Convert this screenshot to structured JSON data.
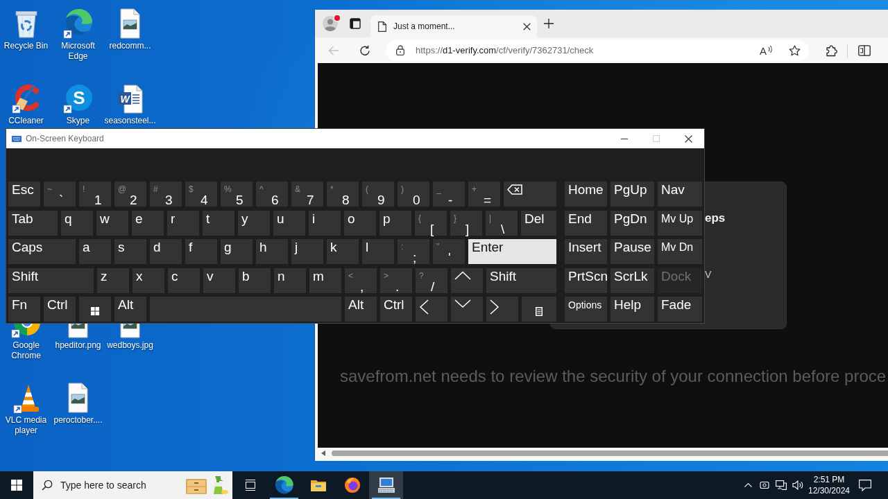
{
  "desktop": {
    "icons": [
      {
        "label": "Recycle Bin",
        "kind": "recycle",
        "shortcut": false
      },
      {
        "label": "CCleaner",
        "kind": "ccleaner",
        "shortcut": true
      },
      {
        "label": "Google Chrome",
        "kind": "chrome",
        "shortcut": true
      },
      {
        "label": "VLC media player",
        "kind": "vlc",
        "shortcut": true
      },
      {
        "label": "Microsoft Edge",
        "kind": "edge",
        "shortcut": true
      },
      {
        "label": "Skype",
        "kind": "skype",
        "shortcut": true,
        "glyph": "S"
      },
      {
        "label": "hpeditor.png",
        "kind": "image",
        "shortcut": false
      },
      {
        "label": "peroctober....",
        "kind": "image",
        "shortcut": false
      },
      {
        "label": "redcomm...",
        "kind": "image",
        "shortcut": false
      },
      {
        "label": "seasonsteel...",
        "kind": "word",
        "shortcut": false,
        "glyph": "W"
      },
      {
        "label": "wedboys.jpg",
        "kind": "image",
        "shortcut": false
      }
    ]
  },
  "browser": {
    "profile_badge": true,
    "tabs": [
      {
        "title": "Just a moment...",
        "selected": true
      }
    ],
    "back": {
      "disabled": true
    },
    "address": {
      "scheme": "https://",
      "host": "d1-verify.com",
      "path": "/cf/verify/7362731/check"
    },
    "read_aloud": {
      "glyph": "A"
    },
    "page": {
      "card": {
        "heading": "eps",
        "line": "V"
      },
      "message": "savefrom.net needs to review the security of your connection before proce"
    }
  },
  "keyboard": {
    "title": "On-Screen Keyboard",
    "controls": [
      {
        "kind": "minimize",
        "disabled": false
      },
      {
        "kind": "maximize",
        "disabled": true
      },
      {
        "kind": "close",
        "disabled": false
      }
    ],
    "main_rows": [
      [
        {
          "kind": "text",
          "label": "Esc",
          "highlighted": false,
          "disabled": false
        },
        {
          "kind": "dual",
          "shift": "~",
          "label": "`",
          "highlighted": false,
          "disabled": false
        },
        {
          "kind": "dual",
          "shift": "!",
          "label": "1",
          "highlighted": false,
          "disabled": false
        },
        {
          "kind": "dual",
          "shift": "@",
          "label": "2",
          "highlighted": false,
          "disabled": false
        },
        {
          "kind": "dual",
          "shift": "#",
          "label": "3",
          "highlighted": false,
          "disabled": false
        },
        {
          "kind": "dual",
          "shift": "$",
          "label": "4",
          "highlighted": false,
          "disabled": false
        },
        {
          "kind": "dual",
          "shift": "%",
          "label": "5",
          "highlighted": false,
          "disabled": false
        },
        {
          "kind": "dual",
          "shift": "^",
          "label": "6",
          "highlighted": false,
          "disabled": false
        },
        {
          "kind": "dual",
          "shift": "&",
          "label": "7",
          "highlighted": false,
          "disabled": false
        },
        {
          "kind": "dual",
          "shift": "*",
          "label": "8",
          "highlighted": false,
          "disabled": false
        },
        {
          "kind": "dual",
          "shift": "(",
          "label": "9",
          "highlighted": false,
          "disabled": false
        },
        {
          "kind": "dual",
          "shift": ")",
          "label": "0",
          "highlighted": false,
          "disabled": false
        },
        {
          "kind": "dual",
          "shift": "_",
          "label": "-",
          "highlighted": false,
          "disabled": false
        },
        {
          "kind": "dual",
          "shift": "+",
          "label": "=",
          "highlighted": false,
          "disabled": false
        },
        {
          "kind": "backspace",
          "highlighted": false,
          "disabled": false
        }
      ],
      [
        {
          "kind": "text",
          "label": "Tab",
          "highlighted": false,
          "disabled": false
        },
        {
          "kind": "text",
          "label": "q",
          "highlighted": false,
          "disabled": false
        },
        {
          "kind": "text",
          "label": "w",
          "highlighted": false,
          "disabled": false
        },
        {
          "kind": "text",
          "label": "e",
          "highlighted": false,
          "disabled": false
        },
        {
          "kind": "text",
          "label": "r",
          "highlighted": false,
          "disabled": false
        },
        {
          "kind": "text",
          "label": "t",
          "highlighted": false,
          "disabled": false
        },
        {
          "kind": "text",
          "label": "y",
          "highlighted": false,
          "disabled": false
        },
        {
          "kind": "text",
          "label": "u",
          "highlighted": false,
          "disabled": false
        },
        {
          "kind": "text",
          "label": "i",
          "highlighted": false,
          "disabled": false
        },
        {
          "kind": "text",
          "label": "o",
          "highlighted": false,
          "disabled": false
        },
        {
          "kind": "text",
          "label": "p",
          "highlighted": false,
          "disabled": false
        },
        {
          "kind": "dual",
          "shift": "{",
          "label": "[",
          "highlighted": false,
          "disabled": false
        },
        {
          "kind": "dual",
          "shift": "}",
          "label": "]",
          "highlighted": false,
          "disabled": false
        },
        {
          "kind": "dual",
          "shift": "|",
          "label": "\\",
          "highlighted": false,
          "disabled": false
        },
        {
          "kind": "text",
          "label": "Del",
          "highlighted": false,
          "disabled": false
        }
      ],
      [
        {
          "kind": "text",
          "label": "Caps",
          "highlighted": false,
          "disabled": false
        },
        {
          "kind": "text",
          "label": "a",
          "highlighted": false,
          "disabled": false
        },
        {
          "kind": "text",
          "label": "s",
          "highlighted": false,
          "disabled": false
        },
        {
          "kind": "text",
          "label": "d",
          "highlighted": false,
          "disabled": false
        },
        {
          "kind": "text",
          "label": "f",
          "highlighted": false,
          "disabled": false
        },
        {
          "kind": "text",
          "label": "g",
          "highlighted": false,
          "disabled": false
        },
        {
          "kind": "text",
          "label": "h",
          "highlighted": false,
          "disabled": false
        },
        {
          "kind": "text",
          "label": "j",
          "highlighted": false,
          "disabled": false
        },
        {
          "kind": "text",
          "label": "k",
          "highlighted": false,
          "disabled": false
        },
        {
          "kind": "text",
          "label": "l",
          "highlighted": false,
          "disabled": false
        },
        {
          "kind": "dual",
          "shift": ":",
          "label": ";",
          "highlighted": false,
          "disabled": false
        },
        {
          "kind": "dual",
          "shift": "\"",
          "label": "'",
          "highlighted": false,
          "disabled": false
        },
        {
          "kind": "text",
          "label": "Enter",
          "highlighted": true,
          "disabled": false
        }
      ],
      [
        {
          "kind": "text",
          "label": "Shift",
          "highlighted": false,
          "disabled": false
        },
        {
          "kind": "text",
          "label": "z",
          "highlighted": false,
          "disabled": false
        },
        {
          "kind": "text",
          "label": "x",
          "highlighted": false,
          "disabled": false
        },
        {
          "kind": "text",
          "label": "c",
          "highlighted": false,
          "disabled": false
        },
        {
          "kind": "text",
          "label": "v",
          "highlighted": false,
          "disabled": false
        },
        {
          "kind": "text",
          "label": "b",
          "highlighted": false,
          "disabled": false
        },
        {
          "kind": "text",
          "label": "n",
          "highlighted": false,
          "disabled": false
        },
        {
          "kind": "text",
          "label": "m",
          "highlighted": false,
          "disabled": false
        },
        {
          "kind": "dual",
          "shift": "<",
          "label": ",",
          "highlighted": false,
          "disabled": false
        },
        {
          "kind": "dual",
          "shift": ">",
          "label": ".",
          "highlighted": false,
          "disabled": false
        },
        {
          "kind": "dual",
          "shift": "?",
          "label": "/",
          "highlighted": false,
          "disabled": false
        },
        {
          "kind": "up",
          "highlighted": false,
          "disabled": false
        },
        {
          "kind": "text",
          "label": "Shift",
          "highlighted": false,
          "disabled": false
        }
      ],
      [
        {
          "kind": "text",
          "label": "Fn",
          "highlighted": false,
          "disabled": false
        },
        {
          "kind": "text",
          "label": "Ctrl",
          "highlighted": false,
          "disabled": false
        },
        {
          "kind": "windows",
          "highlighted": false,
          "disabled": false
        },
        {
          "kind": "text",
          "label": "Alt",
          "highlighted": false,
          "disabled": false
        },
        {
          "kind": "space",
          "highlighted": false,
          "disabled": false
        },
        {
          "kind": "text",
          "label": "Alt",
          "highlighted": false,
          "disabled": false
        },
        {
          "kind": "text",
          "label": "Ctrl",
          "highlighted": false,
          "disabled": false
        },
        {
          "kind": "left",
          "highlighted": false,
          "disabled": false
        },
        {
          "kind": "down",
          "highlighted": false,
          "disabled": false
        },
        {
          "kind": "right",
          "highlighted": false,
          "disabled": false
        },
        {
          "kind": "menu",
          "highlighted": false,
          "disabled": false
        }
      ]
    ],
    "nav_rows": [
      [
        {
          "kind": "text",
          "label": "Home",
          "highlighted": false,
          "disabled": false
        },
        {
          "kind": "text",
          "label": "PgUp",
          "highlighted": false,
          "disabled": false
        },
        {
          "kind": "text",
          "label": "Nav",
          "highlighted": false,
          "disabled": false
        }
      ],
      [
        {
          "kind": "text",
          "label": "End",
          "highlighted": false,
          "disabled": false
        },
        {
          "kind": "text",
          "label": "PgDn",
          "highlighted": false,
          "disabled": false
        },
        {
          "kind": "text",
          "label": "Mv Up",
          "highlighted": false,
          "disabled": false
        }
      ],
      [
        {
          "kind": "text",
          "label": "Insert",
          "highlighted": false,
          "disabled": false
        },
        {
          "kind": "text",
          "label": "Pause",
          "highlighted": false,
          "disabled": false
        },
        {
          "kind": "text",
          "label": "Mv Dn",
          "highlighted": false,
          "disabled": false
        }
      ],
      [
        {
          "kind": "text",
          "label": "PrtScn",
          "highlighted": false,
          "disabled": false
        },
        {
          "kind": "text",
          "label": "ScrLk",
          "highlighted": false,
          "disabled": false
        },
        {
          "kind": "text",
          "label": "Dock",
          "highlighted": false,
          "disabled": true
        }
      ],
      [
        {
          "kind": "text",
          "label": "Options",
          "highlighted": false,
          "disabled": false
        },
        {
          "kind": "text",
          "label": "Help",
          "highlighted": false,
          "disabled": false
        },
        {
          "kind": "text",
          "label": "Fade",
          "highlighted": false,
          "disabled": false
        }
      ]
    ]
  },
  "taskbar": {
    "search": {
      "placeholder": "Type here to search"
    },
    "apps": [
      {
        "kind": "taskview",
        "running": false,
        "active": false
      },
      {
        "kind": "edge",
        "running": true,
        "active": false
      },
      {
        "kind": "explorer",
        "running": false,
        "active": false
      },
      {
        "kind": "firefox",
        "running": false,
        "active": false
      },
      {
        "kind": "keyboard",
        "running": true,
        "active": true
      }
    ],
    "clock": {
      "time": "2:51 PM",
      "date": "12/30/2024"
    }
  }
}
